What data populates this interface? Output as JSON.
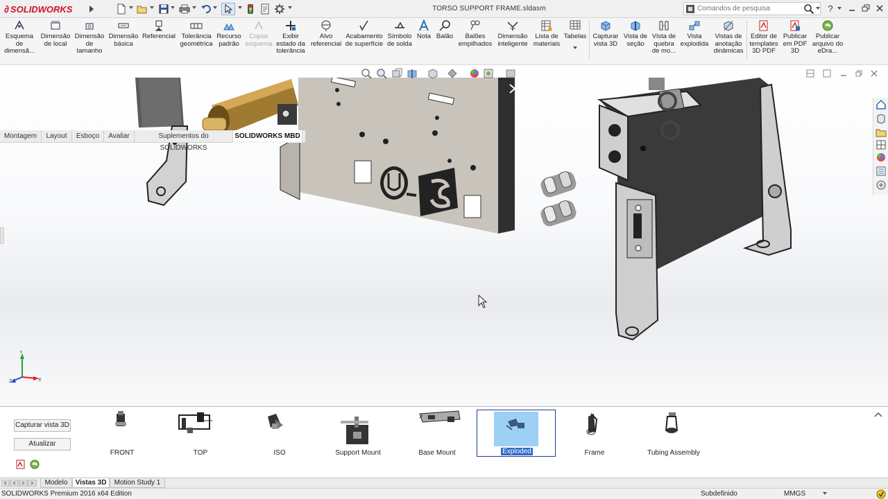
{
  "app": {
    "brand": "SOLIDWORKS",
    "document_title": "TORSO SUPPORT FRAME.sldasm"
  },
  "search": {
    "placeholder": "Comandos de pesquisa"
  },
  "help_label": "?",
  "ribbon": {
    "items": [
      {
        "label": "Esquema de dimensã...",
        "icon": "dimension-scheme-icon",
        "enabled": true
      },
      {
        "label": "Dimensão de local",
        "icon": "location-dimension-icon",
        "enabled": true
      },
      {
        "label": "Dimensão de tamanho",
        "icon": "size-dimension-icon",
        "enabled": true
      },
      {
        "label": "Dimensão básica",
        "icon": "basic-dimension-icon",
        "enabled": true
      },
      {
        "label": "Referencial",
        "icon": "datum-icon",
        "enabled": true
      },
      {
        "label": "Tolerância geométrica",
        "icon": "geometric-tolerance-icon",
        "enabled": true
      },
      {
        "label": "Recurso padrão",
        "icon": "pattern-feature-icon",
        "enabled": true
      },
      {
        "label": "Copiar esquema",
        "icon": "copy-scheme-icon",
        "enabled": false
      },
      {
        "label": "Exibir estado da tolerância",
        "icon": "tolerance-status-icon",
        "enabled": true
      },
      {
        "label": "Alvo referencial",
        "icon": "datum-target-icon",
        "enabled": true
      },
      {
        "label": "Acabamento de superfície",
        "icon": "surface-finish-icon",
        "enabled": true
      },
      {
        "label": "Símbolo de solda",
        "icon": "weld-symbol-icon",
        "enabled": true
      },
      {
        "label": "Nota",
        "icon": "note-icon",
        "enabled": true
      },
      {
        "label": "Balão",
        "icon": "balloon-icon",
        "enabled": true
      },
      {
        "label": "Balões empilhados",
        "icon": "stacked-balloons-icon",
        "enabled": true
      },
      {
        "label": "Dimensão inteligente",
        "icon": "smart-dimension-icon",
        "enabled": true
      },
      {
        "label": "Lista de materiais",
        "icon": "bill-of-materials-icon",
        "enabled": true
      },
      {
        "label": "Tabelas",
        "icon": "tables-icon",
        "enabled": true
      },
      {
        "label": "Capturar vista 3D",
        "icon": "capture-3d-view-icon",
        "enabled": true
      },
      {
        "label": "Vista de seção",
        "icon": "section-view-icon",
        "enabled": true
      },
      {
        "label": "Vista de quebra de mo...",
        "icon": "break-view-icon",
        "enabled": true
      },
      {
        "label": "Vista explodida",
        "icon": "exploded-view-icon",
        "enabled": true
      },
      {
        "label": "Vistas de anotação dinâmicas",
        "icon": "dynamic-annotation-icon",
        "enabled": true
      },
      {
        "label": "Editor de templates 3D PDF",
        "icon": "pdf-template-editor-icon",
        "enabled": true
      },
      {
        "label": "Publicar em PDF 3D",
        "icon": "publish-3d-pdf-icon",
        "enabled": true
      },
      {
        "label": "Publicar arquivo do eDra...",
        "icon": "publish-edrawings-icon",
        "enabled": true
      }
    ]
  },
  "tabs": [
    {
      "label": "Montagem",
      "active": false
    },
    {
      "label": "Layout",
      "active": false
    },
    {
      "label": "Esboço",
      "active": false
    },
    {
      "label": "Avaliar",
      "active": false
    },
    {
      "label": "Suplementos do SOLIDWORKS",
      "active": false
    },
    {
      "label": "SOLIDWORKS MBD",
      "active": true
    }
  ],
  "triad": {
    "x": "X",
    "y": "Y",
    "z": "Z"
  },
  "bottom_pane": {
    "capture_button": "Capturar vista 3D",
    "update_button": "Atualizar",
    "views": [
      {
        "label": "FRONT",
        "selected": false
      },
      {
        "label": "TOP",
        "selected": false
      },
      {
        "label": "ISO",
        "selected": false
      },
      {
        "label": "Support Mount",
        "selected": false
      },
      {
        "label": "Base Mount",
        "selected": false
      },
      {
        "label": "Exploded",
        "selected": true
      },
      {
        "label": "Frame",
        "selected": false
      },
      {
        "label": "Tubing Assembly",
        "selected": false
      }
    ]
  },
  "bottom_tabs": [
    {
      "label": "Modelo",
      "active": false
    },
    {
      "label": "Vistas 3D",
      "active": true
    },
    {
      "label": "Motion Study 1",
      "active": false
    }
  ],
  "status": {
    "app_edition": "SOLIDWORKS Premium 2016 x64 Edition",
    "definition_state": "Subdefinido",
    "units": "MMGS"
  },
  "colors": {
    "brand_red": "#d0102a",
    "selection_blue": "#3169c6",
    "thumb_highlight": "#9ecff5",
    "part_gray": "#c8c4bc",
    "part_dark": "#3a3a3a",
    "brass": "#b8893a"
  }
}
